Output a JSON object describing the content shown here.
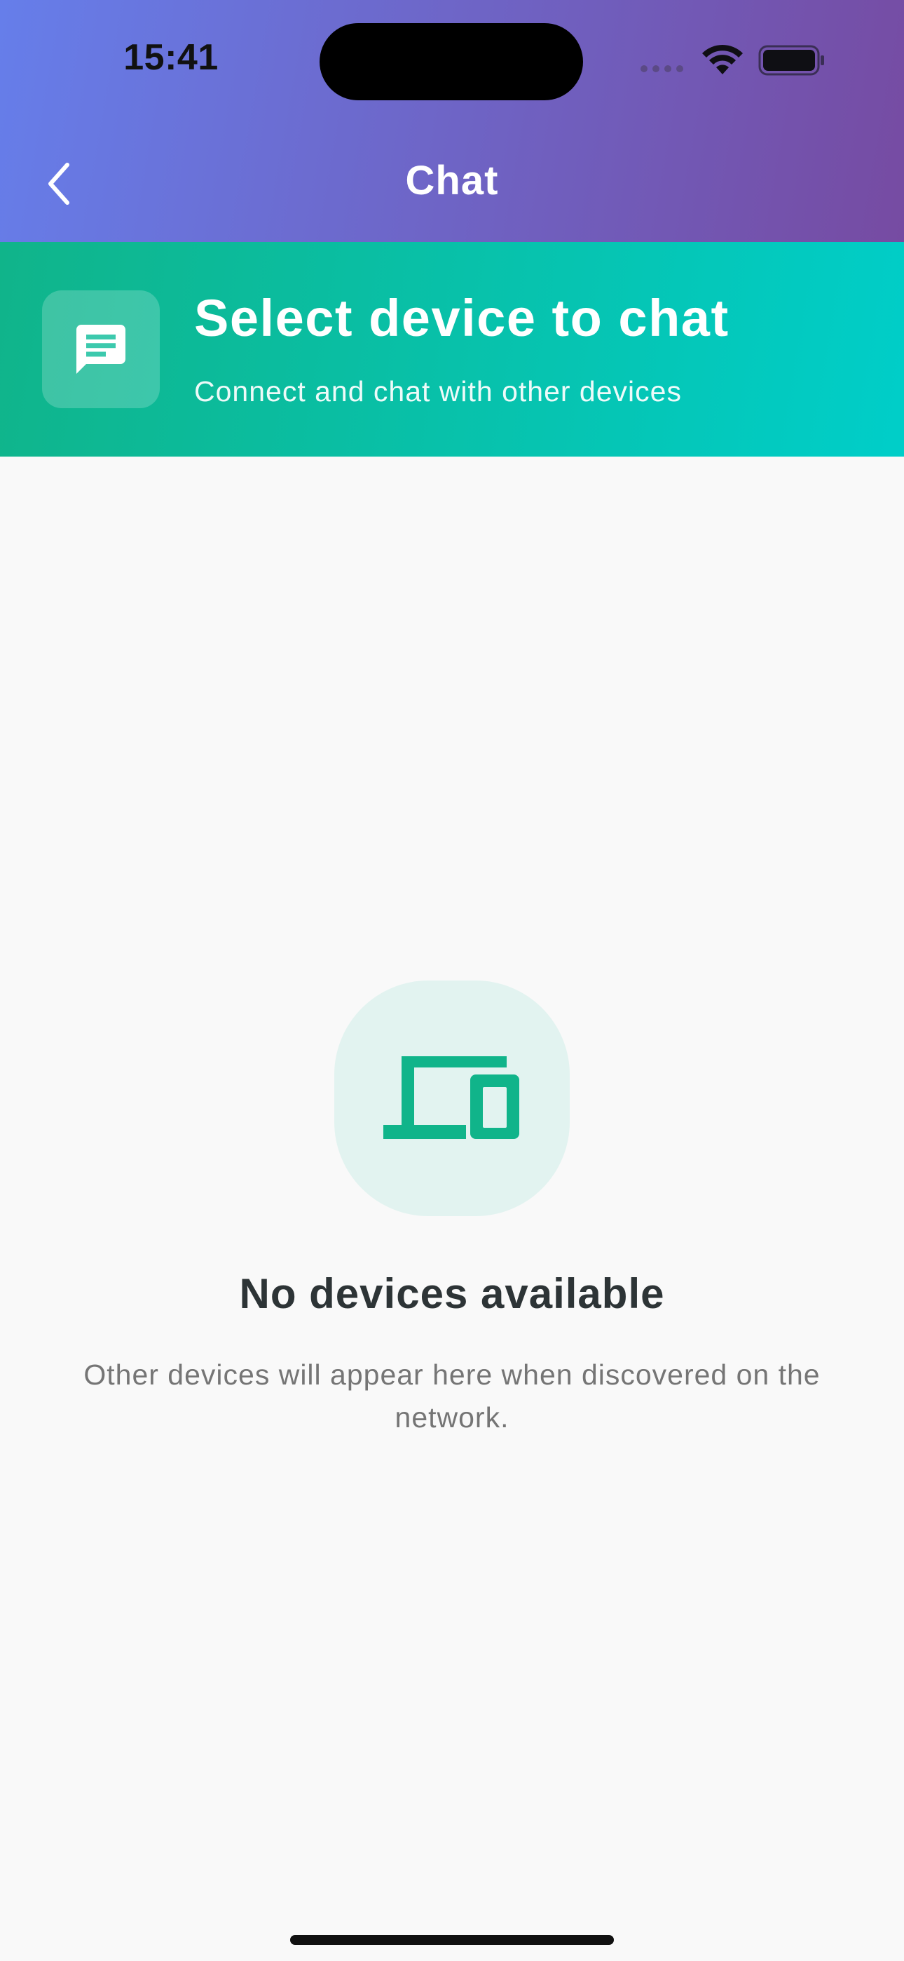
{
  "status_bar": {
    "time": "15:41",
    "icons": [
      "cellular-signal-icon",
      "wifi-icon",
      "battery-icon"
    ]
  },
  "nav_bar": {
    "title": "Chat",
    "back_icon": "chevron-left-icon"
  },
  "banner": {
    "icon": "chat-bubble-icon",
    "title": "Select device to chat",
    "subtitle": "Connect and chat with other devices"
  },
  "empty_state": {
    "icon": "devices-icon",
    "title": "No devices available",
    "message": "Other devices will appear here when discovered on the network."
  },
  "colors": {
    "header_gradient_start": "#667eea",
    "header_gradient_end": "#764ba2",
    "banner_gradient_start": "#10b48a",
    "banner_gradient_end": "#00cec9",
    "accent": "#10b48a",
    "background": "#f9f9f9",
    "empty_title": "#2d3436",
    "empty_message": "#757575"
  }
}
